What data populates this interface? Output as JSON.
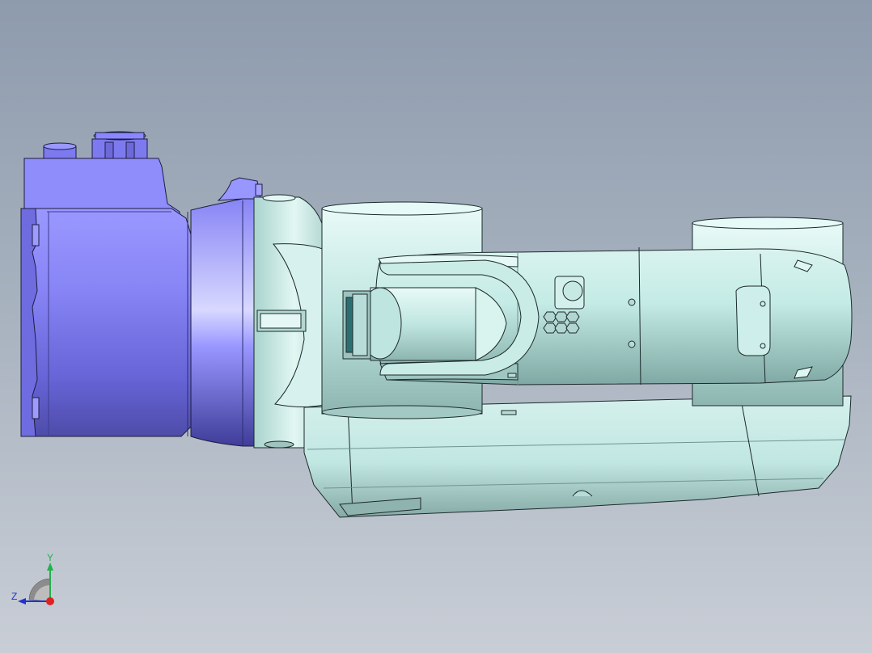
{
  "viewport": {
    "background_top": "#8e9bad",
    "background_bottom": "#c9ced6"
  },
  "model": {
    "base_color": "#7b78ee",
    "arm_color": "#bfe7e2",
    "edge_color": "#1c2a2a"
  },
  "triad": {
    "y_label": "Y",
    "z_label": "Z",
    "y_color": "#22b14c",
    "z_color": "#2233cc",
    "x_color": "#dd2222"
  }
}
